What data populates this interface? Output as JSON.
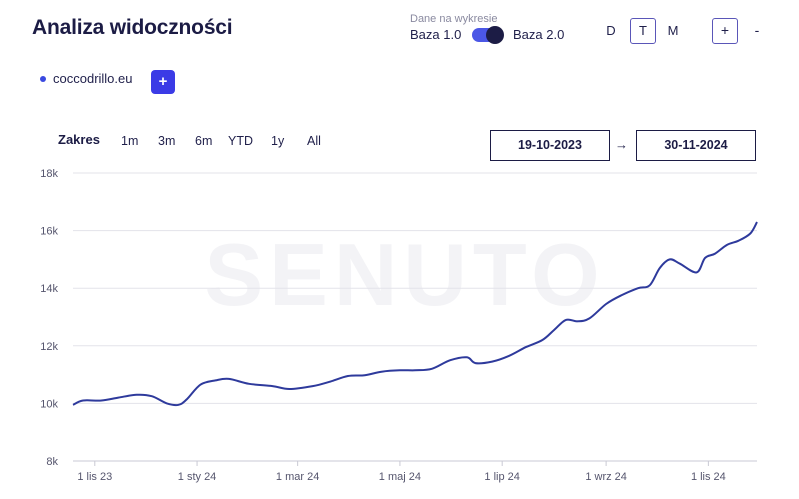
{
  "header": {
    "title": "Analiza widoczności",
    "data_caption": "Dane na wykresie",
    "base_left": "Baza 1.0",
    "base_right": "Baza 2.0",
    "periods": [
      "D",
      "T",
      "M"
    ],
    "active_period": "T",
    "zoom_in": "+",
    "zoom_out": "-"
  },
  "domain": {
    "name": "coccodrillo.eu",
    "color": "#3a49e0",
    "add_label": "+"
  },
  "range": {
    "label": "Zakres",
    "buttons": [
      "1m",
      "3m",
      "6m",
      "YTD",
      "1y",
      "All"
    ],
    "date_from": "19-10-2023",
    "arrow": "→",
    "date_to": "30-11-2024"
  },
  "watermark": "SENUTO",
  "chart_data": {
    "type": "line",
    "x_start": "2023-10-19",
    "x_end": "2024-11-30",
    "x_ticks": [
      {
        "date": "2023-11-01",
        "label": "1 lis 23"
      },
      {
        "date": "2024-01-01",
        "label": "1 sty 24"
      },
      {
        "date": "2024-03-01",
        "label": "1 mar 24"
      },
      {
        "date": "2024-05-01",
        "label": "1 maj 24"
      },
      {
        "date": "2024-07-01",
        "label": "1 lip 24"
      },
      {
        "date": "2024-09-01",
        "label": "1 wrz 24"
      },
      {
        "date": "2024-11-01",
        "label": "1 lis 24"
      }
    ],
    "y_ticks": [
      {
        "value": 8000,
        "label": "8k"
      },
      {
        "value": 10000,
        "label": "10k"
      },
      {
        "value": 12000,
        "label": "12k"
      },
      {
        "value": 14000,
        "label": "14k"
      },
      {
        "value": 16000,
        "label": "16k"
      },
      {
        "value": 18000,
        "label": "18k"
      }
    ],
    "ylim": [
      8000,
      18000
    ],
    "grid": true,
    "series": [
      {
        "line_color": "#2e3a9c",
        "points": [
          [
            "2023-10-19",
            9950
          ],
          [
            "2023-10-25",
            10100
          ],
          [
            "2023-11-05",
            10100
          ],
          [
            "2023-11-15",
            10200
          ],
          [
            "2023-11-26",
            10300
          ],
          [
            "2023-12-05",
            10250
          ],
          [
            "2023-12-14",
            10000
          ],
          [
            "2023-12-21",
            9950
          ],
          [
            "2023-12-26",
            10150
          ],
          [
            "2024-01-03",
            10650
          ],
          [
            "2024-01-12",
            10800
          ],
          [
            "2024-01-20",
            10850
          ],
          [
            "2024-02-01",
            10680
          ],
          [
            "2024-02-15",
            10600
          ],
          [
            "2024-02-25",
            10500
          ],
          [
            "2024-03-10",
            10600
          ],
          [
            "2024-03-20",
            10750
          ],
          [
            "2024-03-31",
            10950
          ],
          [
            "2024-04-10",
            10980
          ],
          [
            "2024-04-20",
            11100
          ],
          [
            "2024-05-01",
            11150
          ],
          [
            "2024-05-10",
            11150
          ],
          [
            "2024-05-20",
            11200
          ],
          [
            "2024-05-31",
            11500
          ],
          [
            "2024-06-10",
            11600
          ],
          [
            "2024-06-15",
            11400
          ],
          [
            "2024-06-25",
            11450
          ],
          [
            "2024-07-05",
            11650
          ],
          [
            "2024-07-15",
            11950
          ],
          [
            "2024-07-25",
            12200
          ],
          [
            "2024-08-01",
            12550
          ],
          [
            "2024-08-08",
            12900
          ],
          [
            "2024-08-15",
            12850
          ],
          [
            "2024-08-22",
            12950
          ],
          [
            "2024-09-01",
            13450
          ],
          [
            "2024-09-10",
            13750
          ],
          [
            "2024-09-20",
            14000
          ],
          [
            "2024-09-27",
            14100
          ],
          [
            "2024-10-03",
            14700
          ],
          [
            "2024-10-09",
            15000
          ],
          [
            "2024-10-15",
            14850
          ],
          [
            "2024-10-25",
            14550
          ],
          [
            "2024-10-30",
            15050
          ],
          [
            "2024-11-05",
            15200
          ],
          [
            "2024-11-12",
            15500
          ],
          [
            "2024-11-19",
            15650
          ],
          [
            "2024-11-26",
            15900
          ],
          [
            "2024-11-30",
            16300
          ]
        ]
      }
    ]
  }
}
